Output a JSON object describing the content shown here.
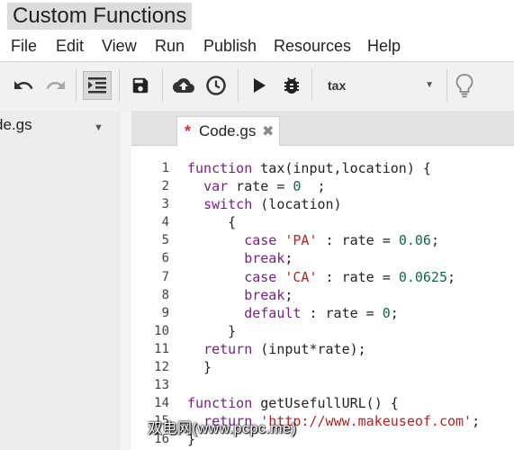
{
  "window": {
    "title": "Custom Functions"
  },
  "menu": {
    "items": [
      {
        "label": "File"
      },
      {
        "label": "Edit"
      },
      {
        "label": "View"
      },
      {
        "label": "Run"
      },
      {
        "label": "Publish"
      },
      {
        "label": "Resources"
      },
      {
        "label": "Help"
      }
    ]
  },
  "toolbar": {
    "buttons": [
      {
        "icon": "undo-icon"
      },
      {
        "icon": "redo-icon"
      },
      {
        "icon": "indent-icon",
        "active": true
      },
      {
        "icon": "save-icon"
      },
      {
        "icon": "cloud-upload-icon"
      },
      {
        "icon": "clock-icon"
      },
      {
        "icon": "run-icon"
      },
      {
        "icon": "debug-icon"
      },
      {
        "icon": "lightbulb-icon"
      }
    ],
    "function_select": {
      "value": "tax"
    }
  },
  "file_panel": {
    "file_name": "de.gs"
  },
  "tabs": [
    {
      "label": "Code.gs",
      "modified": true
    }
  ],
  "editor": {
    "line_numbers": [
      "1",
      "2",
      "3",
      "4",
      "5",
      "6",
      "7",
      "8",
      "9",
      "10",
      "11",
      "12",
      "13",
      "14",
      "15",
      "16"
    ]
  },
  "watermark": "双电网(www.pcpc.me)",
  "colors": {
    "keyword": "#7a1d85",
    "string": "#b22222",
    "number": "#116644",
    "modified_star": "#d32f2f"
  }
}
